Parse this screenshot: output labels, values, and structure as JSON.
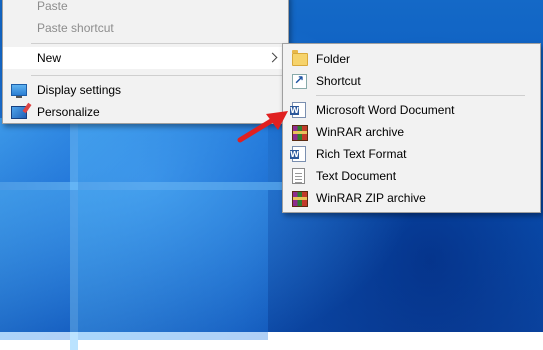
{
  "context_menu": {
    "items": [
      {
        "label": "Paste",
        "disabled": true
      },
      {
        "label": "Paste shortcut",
        "disabled": true
      },
      {
        "label": "New"
      },
      {
        "label": "Display settings",
        "icon": "display-icon"
      },
      {
        "label": "Personalize",
        "icon": "personalize-icon"
      }
    ]
  },
  "new_submenu": {
    "items": [
      {
        "label": "Folder",
        "icon": "folder-icon"
      },
      {
        "label": "Shortcut",
        "icon": "shortcut-icon"
      },
      {
        "label": "Microsoft Word Document",
        "icon": "word-document-icon"
      },
      {
        "label": "WinRAR archive",
        "icon": "winrar-icon"
      },
      {
        "label": "Rich Text Format",
        "icon": "word-document-icon"
      },
      {
        "label": "Text Document",
        "icon": "text-document-icon"
      },
      {
        "label": "WinRAR ZIP archive",
        "icon": "winrar-icon"
      }
    ]
  },
  "colors": {
    "menu_background": "#f2f2f2",
    "highlight": "#ffffff",
    "disabled_text": "#8d8d8d",
    "annotation_arrow": "#e02020",
    "desktop_blue": "#0a5ac0"
  }
}
